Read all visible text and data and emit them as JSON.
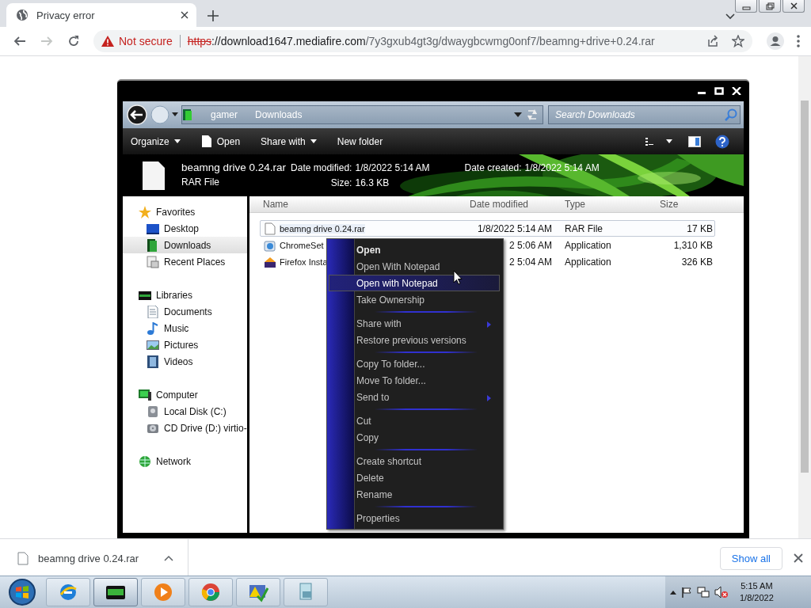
{
  "browser": {
    "tab": {
      "title": "Privacy error"
    },
    "security": "Not secure",
    "url_scheme": "https",
    "url_host": "://download1647.mediafire.com",
    "url_path": "/7y3gxub4gt3g/dwaygbcwmg0onf7/beamng+drive+0.24.rar"
  },
  "explorer": {
    "breadcrumbs": [
      "gamer",
      "Downloads"
    ],
    "search": {
      "placeholder": "Search Downloads"
    },
    "commands": [
      {
        "label": "Organize",
        "kind": "menu"
      },
      {
        "label": "Open",
        "kind": "file"
      },
      {
        "label": "Share with",
        "kind": "menu"
      },
      {
        "label": "New folder",
        "kind": "plain"
      }
    ],
    "details": {
      "name": "beamng drive 0.24.rar",
      "type": "RAR File",
      "columns": [
        [
          {
            "label": "Date modified:",
            "value": "1/8/2022 5:14 AM"
          },
          {
            "label": "Size:",
            "value": "16.3 KB"
          }
        ],
        [
          {
            "label": "Date created:",
            "value": "1/8/2022 5:14 AM"
          }
        ]
      ]
    },
    "navigation": [
      {
        "label": "Favorites",
        "kind": "star",
        "selected": false,
        "children": [
          {
            "label": "Desktop",
            "kind": "desktop",
            "selected": false
          },
          {
            "label": "Downloads",
            "kind": "downloads",
            "selected": true
          },
          {
            "label": "Recent Places",
            "kind": "recent",
            "selected": false
          }
        ]
      },
      {
        "label": "Libraries",
        "kind": "library",
        "selected": false,
        "children": [
          {
            "label": "Documents",
            "kind": "documents",
            "selected": false
          },
          {
            "label": "Music",
            "kind": "music",
            "selected": false
          },
          {
            "label": "Pictures",
            "kind": "pictures",
            "selected": false
          },
          {
            "label": "Videos",
            "kind": "videos",
            "selected": false
          }
        ]
      },
      {
        "label": "Computer",
        "kind": "computer",
        "selected": false,
        "children": [
          {
            "label": "Local Disk (C:)",
            "kind": "disk",
            "selected": false
          },
          {
            "label": "CD Drive (D:) virtio-",
            "kind": "cd",
            "selected": false
          }
        ]
      },
      {
        "label": "Network",
        "kind": "network",
        "selected": false
      }
    ],
    "columns": [
      "Name",
      "Date modified",
      "Type",
      "Size"
    ],
    "files": [
      {
        "name": "beamng drive 0.24.rar",
        "date": "1/8/2022 5:14 AM",
        "type": "RAR File",
        "size": "17 KB",
        "kind": "document",
        "selected": true
      },
      {
        "name": "ChromeSet",
        "date": "2 5:06 AM",
        "type": "Application",
        "size": "1,310 KB",
        "kind": "installer",
        "selected": false
      },
      {
        "name": "Firefox Insta",
        "date": "2 5:04 AM",
        "type": "Application",
        "size": "326 KB",
        "kind": "box",
        "selected": false
      }
    ]
  },
  "context_menu": {
    "groups": [
      [
        {
          "label": "Open",
          "default": true,
          "selected": false,
          "submenu": false
        },
        {
          "label": "Open With Notepad",
          "default": false,
          "selected": false,
          "submenu": false
        },
        {
          "label": "Open with Notepad",
          "default": false,
          "selected": true,
          "submenu": false
        },
        {
          "label": "Take Ownership",
          "default": false,
          "selected": false,
          "submenu": false
        }
      ],
      [
        {
          "label": "Share with",
          "default": false,
          "selected": false,
          "submenu": true
        },
        {
          "label": "Restore previous versions",
          "default": false,
          "selected": false,
          "submenu": false
        }
      ],
      [
        {
          "label": "Copy To folder...",
          "default": false,
          "selected": false,
          "submenu": false
        },
        {
          "label": "Move To folder...",
          "default": false,
          "selected": false,
          "submenu": false
        },
        {
          "label": "Send to",
          "default": false,
          "selected": false,
          "submenu": true
        }
      ],
      [
        {
          "label": "Cut",
          "default": false,
          "selected": false,
          "submenu": false
        },
        {
          "label": "Copy",
          "default": false,
          "selected": false,
          "submenu": false
        }
      ],
      [
        {
          "label": "Create shortcut",
          "default": false,
          "selected": false,
          "submenu": false
        },
        {
          "label": "Delete",
          "default": false,
          "selected": false,
          "submenu": false
        },
        {
          "label": "Rename",
          "default": false,
          "selected": false,
          "submenu": false
        }
      ],
      [
        {
          "label": "Properties",
          "default": false,
          "selected": false,
          "submenu": false
        }
      ]
    ]
  },
  "downloads": {
    "file": "beamng drive 0.24.rar",
    "show_all": "Show all"
  },
  "taskbar": {
    "apps": [
      {
        "kind": "globe",
        "active": false
      },
      {
        "kind": "window",
        "active": true
      },
      {
        "kind": "play",
        "active": false
      },
      {
        "kind": "browser",
        "active": false
      },
      {
        "kind": "warning",
        "active": false
      },
      {
        "kind": "document",
        "active": false
      }
    ],
    "clock": {
      "time": "5:15 AM",
      "date": "1/8/2022"
    }
  }
}
